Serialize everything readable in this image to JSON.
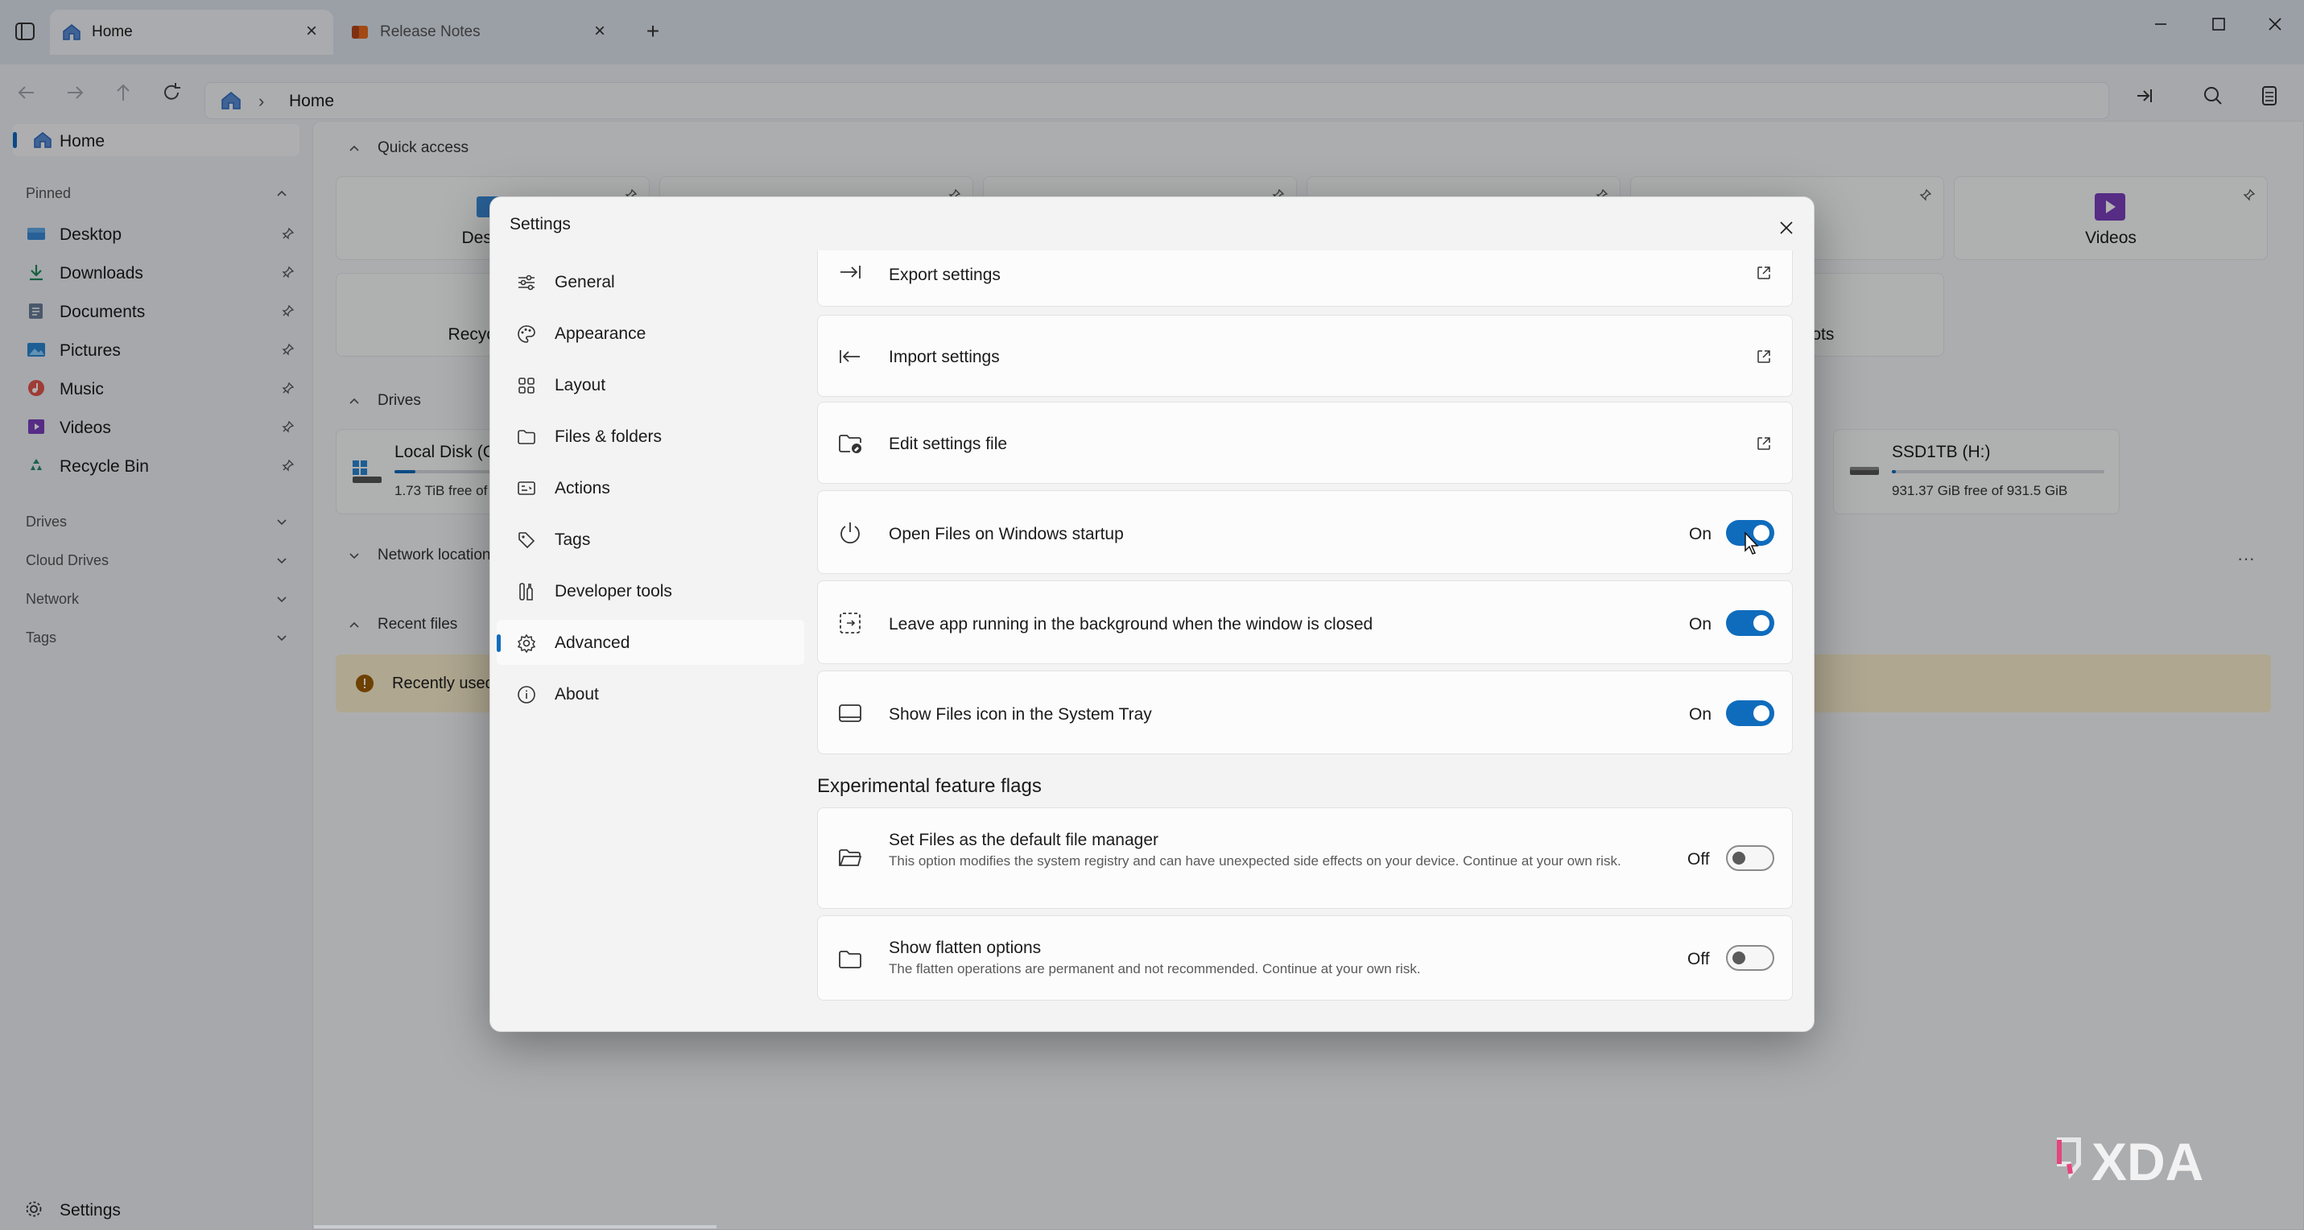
{
  "tabs": [
    {
      "label": "Home",
      "active": true,
      "icon": "home-icon"
    },
    {
      "label": "Release Notes",
      "active": false,
      "icon": "release-notes-icon"
    }
  ],
  "address": {
    "crumb": "Home"
  },
  "sidebar": {
    "home": "Home",
    "pinned_header": "Pinned",
    "pinned": [
      {
        "label": "Desktop",
        "icon": "desktop-icon"
      },
      {
        "label": "Downloads",
        "icon": "downloads-icon"
      },
      {
        "label": "Documents",
        "icon": "documents-icon"
      },
      {
        "label": "Pictures",
        "icon": "pictures-icon"
      },
      {
        "label": "Music",
        "icon": "music-icon"
      },
      {
        "label": "Videos",
        "icon": "videos-icon"
      },
      {
        "label": "Recycle Bin",
        "icon": "recycle-bin-icon"
      }
    ],
    "sections": [
      "Drives",
      "Cloud Drives",
      "Network",
      "Tags"
    ],
    "settings": "Settings"
  },
  "main": {
    "quick_access": "Quick access",
    "qa_cards": [
      "Desktop",
      "",
      "",
      "",
      "",
      "Videos"
    ],
    "qa_row2": [
      "Recycle Bin",
      "Screenshots"
    ],
    "drives_header": "Drives",
    "drives": [
      {
        "name": "Local Disk (C:)",
        "free": "1.73 TiB free of",
        "fill": 0.1
      },
      {
        "name": "SSD1TB (H:)",
        "free": "931.37 GiB free of 931.5 GiB",
        "fill": 0.01
      }
    ],
    "network_header": "Network locations",
    "recent_header": "Recent files",
    "recent_warning": "Recently used files are currently disabled"
  },
  "dialog": {
    "title": "Settings",
    "nav": [
      {
        "label": "General",
        "icon": "sliders-icon"
      },
      {
        "label": "Appearance",
        "icon": "palette-icon"
      },
      {
        "label": "Layout",
        "icon": "layout-grid-icon"
      },
      {
        "label": "Files & folders",
        "icon": "folder-icon"
      },
      {
        "label": "Actions",
        "icon": "actions-icon"
      },
      {
        "label": "Tags",
        "icon": "tag-icon"
      },
      {
        "label": "Developer tools",
        "icon": "developer-tools-icon"
      },
      {
        "label": "Advanced",
        "icon": "advanced-icon",
        "selected": true
      },
      {
        "label": "About",
        "icon": "info-icon"
      }
    ],
    "rows": {
      "export": "Export settings",
      "import": "Import settings",
      "edit": "Edit settings file",
      "startup": {
        "label": "Open Files on Windows startup",
        "state": "On"
      },
      "background": {
        "label": "Leave app running in the background when the window is closed",
        "state": "On"
      },
      "tray": {
        "label": "Show Files icon in the System Tray",
        "state": "On"
      }
    },
    "experimental_header": "Experimental feature flags",
    "experimental": {
      "default_manager": {
        "label": "Set Files as the default file manager",
        "desc": "This option modifies the system registry and can have unexpected side effects on your device. Continue at your own risk.",
        "state": "Off"
      },
      "flatten": {
        "label": "Show flatten options",
        "desc": "The flatten operations are permanent and not recommended. Continue at your own risk.",
        "state": "Off"
      }
    }
  },
  "watermark": "XDA",
  "colors": {
    "accent": "#0f6cbd",
    "warning_bg": "#fbf0cf"
  }
}
